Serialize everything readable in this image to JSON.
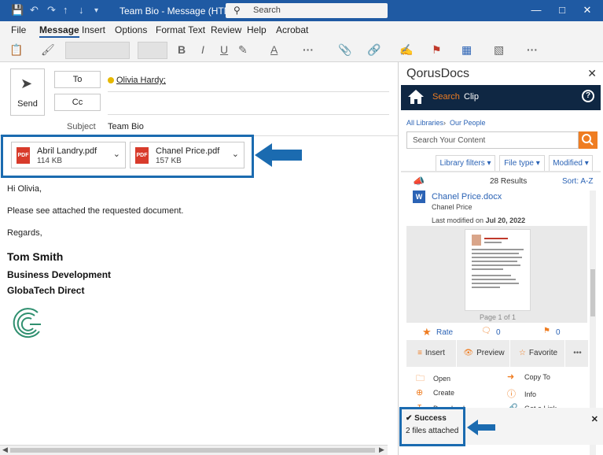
{
  "titlebar": {
    "title": "Team Bio - Message (HTML)",
    "search_placeholder": "Search"
  },
  "menu": [
    "File",
    "Message",
    "Insert",
    "Options",
    "Format Text",
    "Review",
    "Help",
    "Acrobat"
  ],
  "compose": {
    "send_label": "Send",
    "to_label": "To",
    "cc_label": "Cc",
    "to_recipient": "Olivia Hardy;",
    "subject_label": "Subject",
    "subject_value": "Team Bio"
  },
  "attachments": [
    {
      "name": "Abril Landry.pdf",
      "size": "114 KB",
      "type_label": "PDF"
    },
    {
      "name": "Chanel Price.pdf",
      "size": "157 KB",
      "type_label": "PDF"
    }
  ],
  "body": {
    "greeting": "Hi Olivia,",
    "line1": "Please see attached the requested document.",
    "closing": "Regards,",
    "sig_name": "Tom Smith",
    "sig_dept": "Business Development",
    "sig_company": "GlobaTech Direct"
  },
  "qorus": {
    "header": "QorusDocs",
    "tabs": {
      "search": "Search",
      "clip": "Clip"
    },
    "help": "?",
    "crumbs": {
      "all": "All Libraries",
      "sep": "›",
      "current": "Our People"
    },
    "search_placeholder": "Search Your Content",
    "filters": {
      "library": "Library filters",
      "filetype": "File type",
      "modified": "Modified"
    },
    "results": "28 Results",
    "sort": "Sort:  A-Z",
    "doc": {
      "title": "Chanel Price.docx",
      "author": "Chanel Price",
      "modified_prefix": "Last modified on",
      "modified_date": "Jul 20, 2022"
    },
    "page_info": "Page 1 of 1",
    "rate_label": "Rate",
    "comments_count": "0",
    "flags_count": "0",
    "actions": {
      "insert": "Insert",
      "preview": "Preview",
      "favorite": "Favorite",
      "more": "•••"
    },
    "commands": {
      "open": "Open",
      "copy_to": "Copy To",
      "create": "Create",
      "info": "Info",
      "download": "Download",
      "get_link": "Get a Link"
    },
    "toast": {
      "title": "Success",
      "message": "2 files attached"
    }
  },
  "colors": {
    "titlebar": "#1f5aa3",
    "accent_orange": "#ef7d22",
    "qorus_nav": "#0f2743",
    "highlight": "#1b6bb0"
  }
}
